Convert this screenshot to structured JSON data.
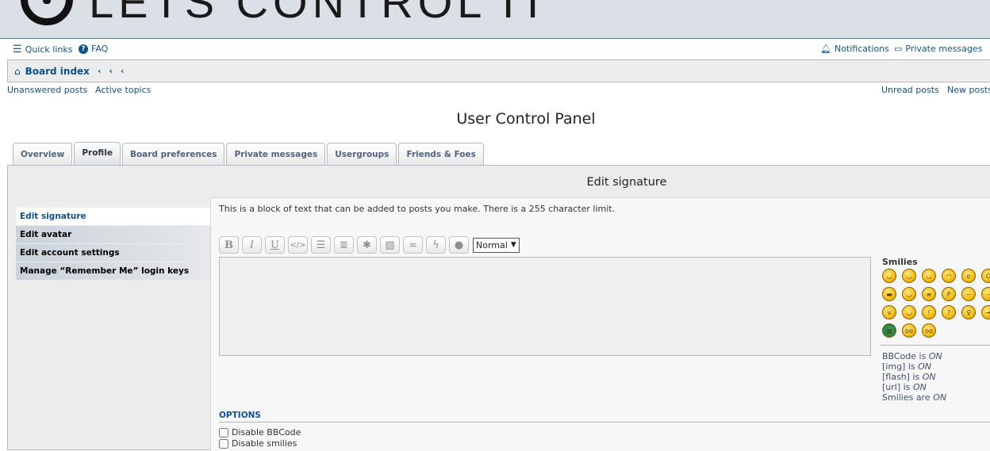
{
  "header": {
    "logo_text": "LETS CONTROL IT"
  },
  "nav": {
    "quick_links": "Quick links",
    "faq": "FAQ",
    "notifications": "Notifications",
    "private_messages": "Private messages"
  },
  "breadcrumb": {
    "board_index": "Board index"
  },
  "links": {
    "unanswered": "Unanswered posts",
    "active": "Active topics",
    "unread": "Unread posts",
    "new": "New posts"
  },
  "page_title": "User Control Panel",
  "tabs": [
    {
      "label": "Overview"
    },
    {
      "label": "Profile",
      "active": true
    },
    {
      "label": "Board preferences"
    },
    {
      "label": "Private messages"
    },
    {
      "label": "Usergroups"
    },
    {
      "label": "Friends & Foes"
    }
  ],
  "panel_title": "Edit signature",
  "menu": [
    {
      "label": "Edit signature",
      "active": true
    },
    {
      "label": "Edit avatar"
    },
    {
      "label": "Edit account settings"
    },
    {
      "label": "Manage “Remember Me” login keys"
    }
  ],
  "description": "This is a block of text that can be added to posts you make. There is a 255 character limit.",
  "toolbar": {
    "buttons": [
      "bold",
      "italic",
      "underline",
      "code",
      "list",
      "list-numbered",
      "list-item",
      "image",
      "link",
      "flash",
      "color"
    ],
    "font_size": "Normal"
  },
  "signature_value": "",
  "smilies": {
    "title": "Smilies",
    "icons": [
      "very-happy",
      "smile",
      "wink",
      "sad",
      "surprised",
      "shocked",
      "cool",
      "laughing",
      "mad",
      "razz",
      "embarrassed",
      "neutral",
      "evil",
      "twisted-evil",
      "exclamation",
      "question",
      "idea",
      "arrow",
      "green",
      "geek",
      "uber-geek"
    ]
  },
  "status": {
    "bbcode": "BBCode is",
    "img": "[img] is",
    "flash": "[flash] is",
    "url": "[url] is",
    "smilies": "Smilies are",
    "on": "ON"
  },
  "options": {
    "title": "OPTIONS",
    "disable_bbcode": "Disable BBCode",
    "disable_smilies": "Disable smilies"
  }
}
